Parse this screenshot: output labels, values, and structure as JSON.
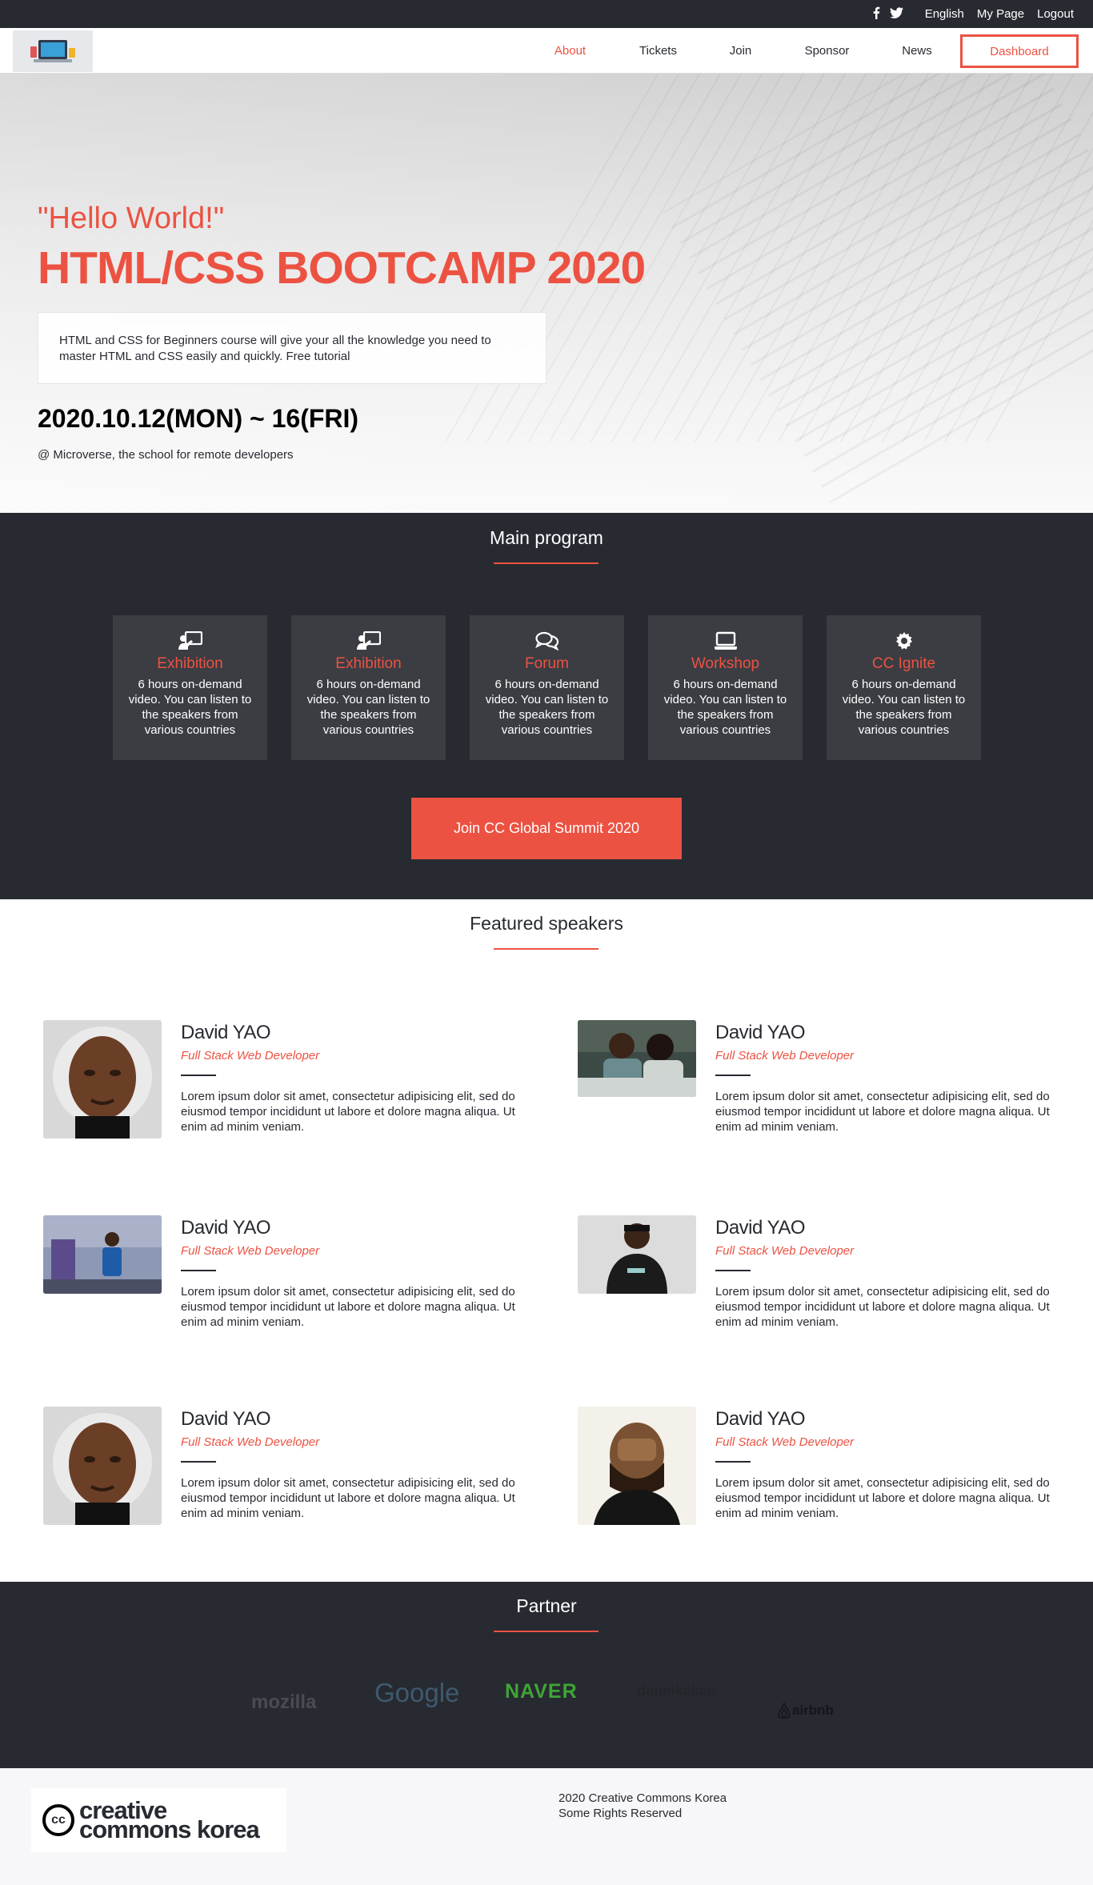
{
  "topbar": {
    "lang": "English",
    "mypage": "My Page",
    "logout": "Logout",
    "icons": [
      "facebook-icon",
      "twitter-icon"
    ]
  },
  "nav": {
    "items": [
      {
        "label": "About",
        "active": true
      },
      {
        "label": "Tickets"
      },
      {
        "label": "Join"
      },
      {
        "label": "Sponsor"
      },
      {
        "label": "News"
      }
    ],
    "dashboard": "Dashboard"
  },
  "hero": {
    "tagline": "\"Hello World!\"",
    "title": "HTML/CSS BOOTCAMP 2020",
    "description": "HTML and CSS for Beginners course will give your all the knowledge you need to master HTML and CSS easily and quickly. Free tutorial",
    "date": "2020.10.12(MON) ~ 16(FRI)",
    "place": "@ Microverse, the school for remote developers"
  },
  "program": {
    "title": "Main program",
    "cards": [
      {
        "icon": "presentation-icon",
        "title": "Exhibition",
        "text": "6 hours on-demand video. You can listen to the speakers from various countries"
      },
      {
        "icon": "presentation-icon",
        "title": "Exhibition",
        "text": "6 hours on-demand video. You can listen to the speakers from various countries"
      },
      {
        "icon": "comments-icon",
        "title": "Forum",
        "text": "6 hours on-demand video. You can listen to the speakers from various countries"
      },
      {
        "icon": "laptop-icon",
        "title": "Workshop",
        "text": "6 hours on-demand video. You can listen to the speakers from various countries"
      },
      {
        "icon": "gear-icon",
        "title": "CC Ignite",
        "text": "6 hours on-demand video. You can listen to the speakers from various countries"
      }
    ],
    "join_button": "Join CC Global Summit 2020"
  },
  "speakers": {
    "title": "Featured speakers",
    "items": [
      {
        "name": "David YAO",
        "role": "Full Stack Web Developer",
        "bio": "Lorem ipsum dolor sit amet, consectetur adipisicing elit, sed do eiusmod tempor incididunt ut labore et dolore magna aliqua. Ut enim ad minim veniam."
      },
      {
        "name": "David YAO",
        "role": "Full Stack Web Developer",
        "bio": "Lorem ipsum dolor sit amet, consectetur adipisicing elit, sed do eiusmod tempor incididunt ut labore et dolore magna aliqua. Ut enim ad minim veniam."
      },
      {
        "name": "David YAO",
        "role": "Full Stack Web Developer",
        "bio": "Lorem ipsum dolor sit amet, consectetur adipisicing elit, sed do eiusmod tempor incididunt ut labore et dolore magna aliqua. Ut enim ad minim veniam."
      },
      {
        "name": "David YAO",
        "role": "Full Stack Web Developer",
        "bio": "Lorem ipsum dolor sit amet, consectetur adipisicing elit, sed do eiusmod tempor incididunt ut labore et dolore magna aliqua. Ut enim ad minim veniam."
      },
      {
        "name": "David YAO",
        "role": "Full Stack Web Developer",
        "bio": "Lorem ipsum dolor sit amet, consectetur adipisicing elit, sed do eiusmod tempor incididunt ut labore et dolore magna aliqua. Ut enim ad minim veniam."
      },
      {
        "name": "David YAO",
        "role": "Full Stack Web Developer",
        "bio": "Lorem ipsum dolor sit amet, consectetur adipisicing elit, sed do eiusmod tempor incididunt ut labore et dolore magna aliqua. Ut enim ad minim veniam."
      }
    ]
  },
  "partner": {
    "title": "Partner",
    "logos": [
      "mozilla",
      "Google",
      "NAVER",
      "daumkakao",
      "airbnb"
    ]
  },
  "footer": {
    "logo_text_1": "creative",
    "logo_text_2": "commons korea",
    "cc": "cc",
    "copyright_1": "2020 Creative Commons Korea",
    "copyright_2": "Some Rights Reserved"
  },
  "colors": {
    "accent": "#ec5242",
    "dark": "#272a31",
    "card": "#3b3d43"
  }
}
